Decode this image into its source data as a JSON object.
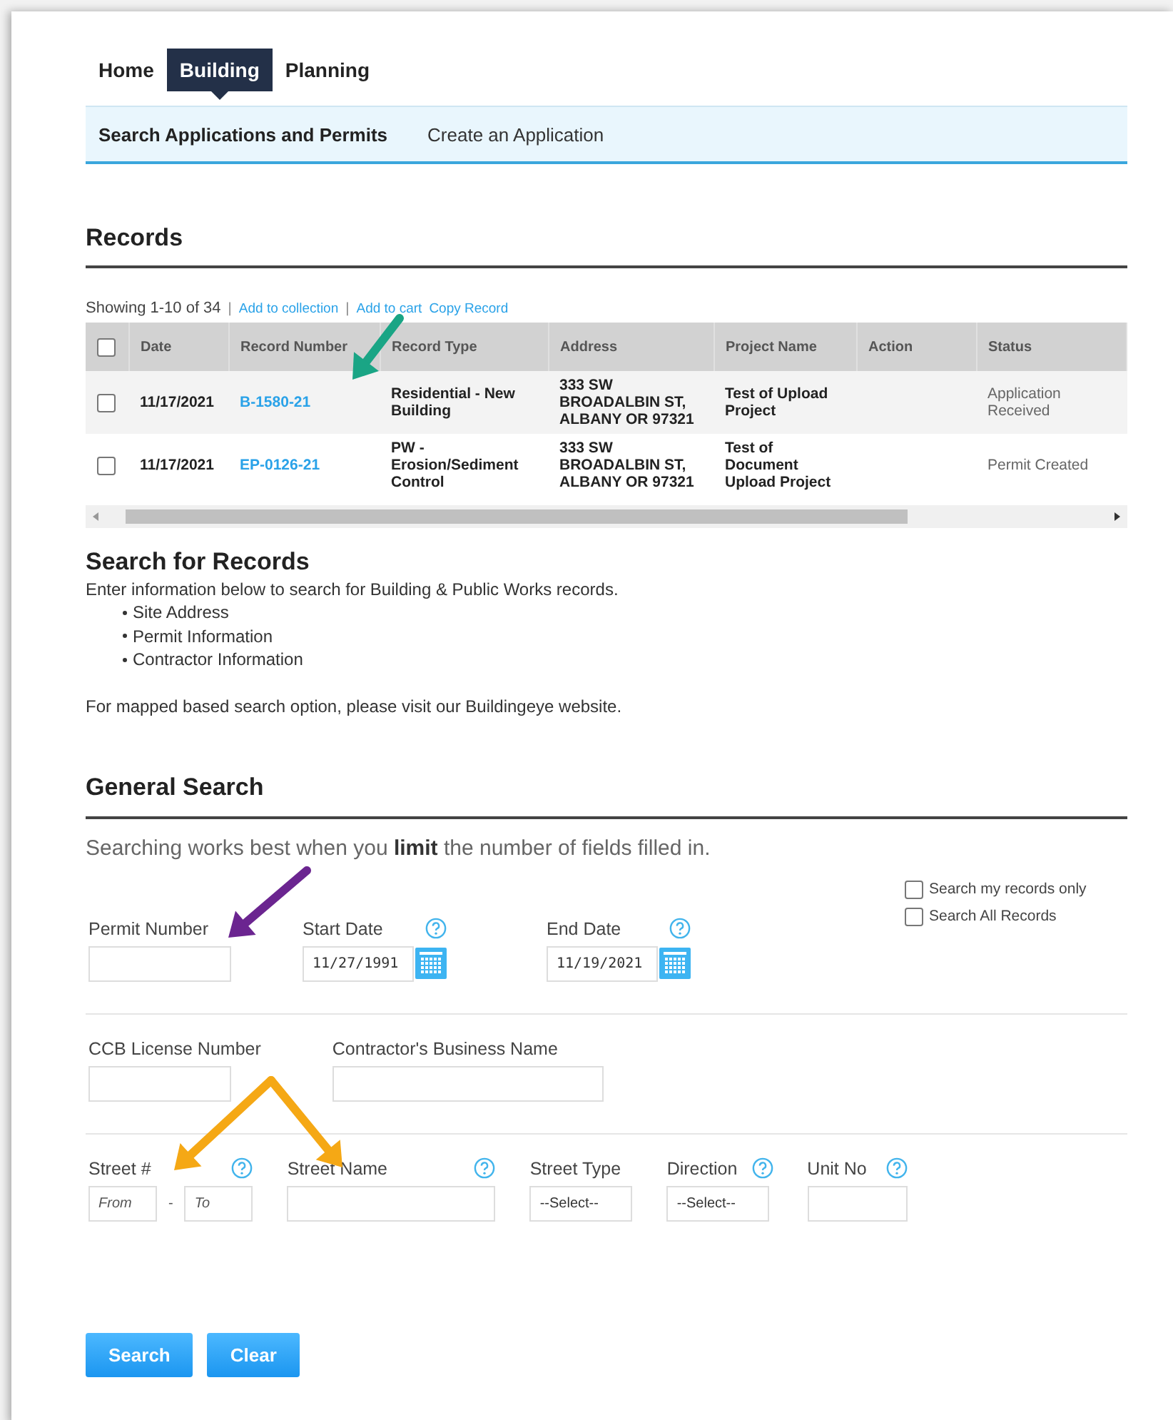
{
  "nav": {
    "tabs": [
      {
        "label": "Home",
        "selected": false
      },
      {
        "label": "Building",
        "selected": true
      },
      {
        "label": "Planning",
        "selected": false
      }
    ]
  },
  "subnav": {
    "items": [
      {
        "label": "Search Applications and Permits",
        "selected": true
      },
      {
        "label": "Create an Application",
        "selected": false
      }
    ]
  },
  "records": {
    "title": "Records",
    "summary": "Showing 1-10 of 34",
    "actions": [
      "Add to collection",
      "Add to cart",
      "Copy Record"
    ],
    "separator": "|",
    "table": {
      "select_all_checked": false,
      "columns": [
        "Date",
        "Record Number",
        "Record Type",
        "Address",
        "Project Name",
        "Action",
        "Status"
      ],
      "rows": [
        {
          "checked": false,
          "date": "11/17/2021",
          "record_number": "B-1580-21",
          "record_type": "Residential - New Building",
          "address": "333 SW BROADALBIN ST, ALBANY OR 97321",
          "project_name": "Test of Upload Project",
          "status": "Application Received"
        },
        {
          "checked": false,
          "date": "11/17/2021",
          "record_number": "EP-0126-21",
          "record_type": "PW - Erosion/Sediment Control",
          "address": "333 SW BROADALBIN ST, ALBANY OR 97321",
          "project_name": "Test of Document Upload Project",
          "status": "Permit Created"
        }
      ]
    }
  },
  "search_for_records": {
    "title": "Search for Records",
    "intro": "Enter information below to search for Building & Public Works records.",
    "bullets": [
      "Site Address",
      "Permit Information",
      "Contractor Information"
    ],
    "note": "For mapped based search option, please visit our Buildingeye website."
  },
  "general_search": {
    "title": "General Search",
    "hint": "Searching works best when you **limit** the number of fields filled in.",
    "options": [
      {
        "label": "Search my records only",
        "checked": false
      },
      {
        "label": "Search All Records",
        "checked": false
      }
    ],
    "field_rows": [
      [
        {
          "kind": "text",
          "label": "Permit Number"
        },
        {
          "kind": "date",
          "label": "Start Date",
          "value": "11/27/1991",
          "help": true
        },
        {
          "kind": "date",
          "label": "End Date",
          "value": "11/19/2021",
          "help": true
        }
      ],
      [
        {
          "kind": "text",
          "label": "CCB License Number"
        },
        {
          "kind": "wide",
          "label": "Contractor's Business Name"
        }
      ],
      [
        {
          "kind": "range",
          "label": "Street #",
          "from_placeholder": "From",
          "separator": "-",
          "to_placeholder": "To",
          "help": true
        },
        {
          "kind": "wide",
          "label": "Street Name",
          "help": true
        },
        {
          "kind": "select",
          "label": "Street Type",
          "value": "--Select--"
        },
        {
          "kind": "select",
          "label": "Direction",
          "value": "--Select--",
          "help": true
        },
        {
          "kind": "text",
          "label": "Unit No",
          "help": true
        }
      ]
    ],
    "buttons": [
      "Search",
      "Clear"
    ]
  },
  "annotations": [
    {
      "color": "#1aa585"
    },
    {
      "color": "#6b2590"
    },
    {
      "color": "#f5a815"
    },
    {
      "color": "#f5a815"
    }
  ]
}
